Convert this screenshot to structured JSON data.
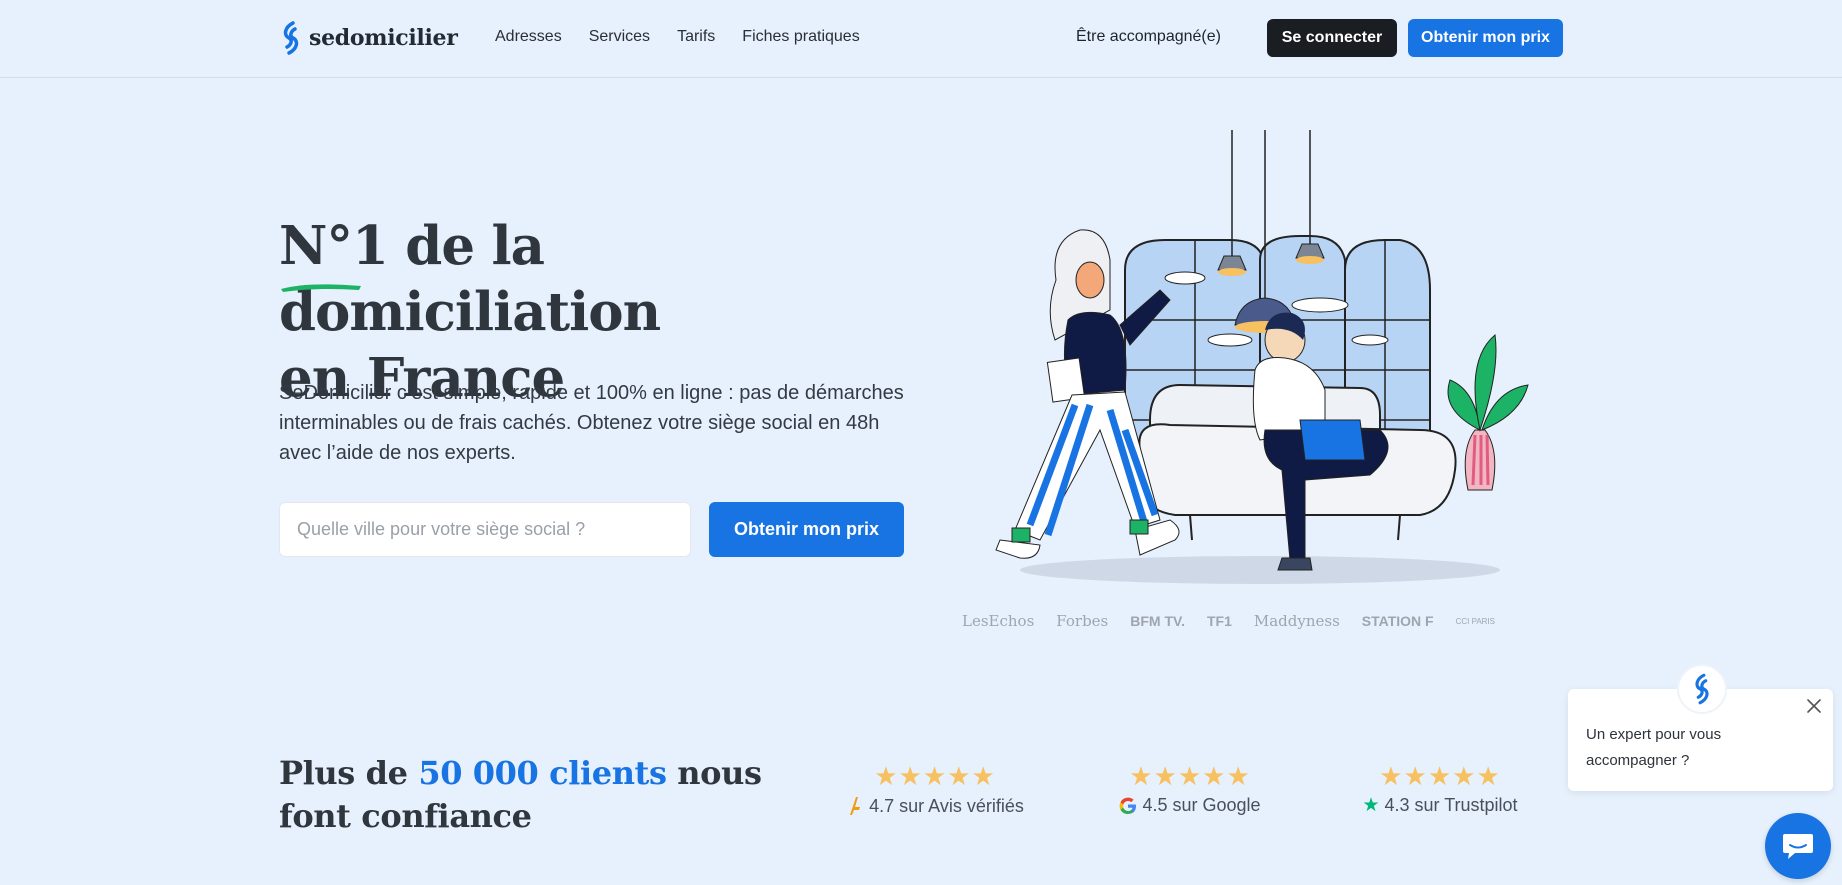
{
  "header": {
    "brand": "sedomicilier",
    "nav": [
      "Adresses",
      "Services",
      "Tarifs",
      "Fiches pratiques"
    ],
    "accompany_label": "Être accompagné(e)",
    "login_label": "Se connecter",
    "price_label": "Obtenir mon prix"
  },
  "hero": {
    "title_line1": "N°1 de la domiciliation",
    "title_line2": "en France",
    "description": "SeDomicilier c’est simple, rapide et 100% en ligne : pas de démarches interminables ou de frais cachés. Obtenez votre siège social en 48h avec l’aide de nos experts.",
    "city_placeholder": "Quelle ville pour votre siège social ?",
    "cta_label": "Obtenir mon prix"
  },
  "press": {
    "logos": [
      "LesEchos",
      "Forbes",
      "BFM TV.",
      "TF1",
      "Maddyness",
      "STATION F",
      "CCI PARIS"
    ]
  },
  "clients": {
    "title_prefix": "Plus de ",
    "title_accent": "50 000 clients",
    "title_suffix": " nous font confiance",
    "ratings": [
      {
        "stars": "★★★★★",
        "text": "4.7 sur Avis vérifiés",
        "icon": "avis-verifies-icon"
      },
      {
        "stars": "★★★★★",
        "text": "4.5 sur Google",
        "icon": "google-icon"
      },
      {
        "stars": "★★★★★",
        "text": "4.3 sur Trustpilot",
        "icon": "trustpilot-star-icon"
      }
    ]
  },
  "chat": {
    "message": "Un expert pour vous accompagner ?"
  },
  "colors": {
    "background": "#e6f1fd",
    "accent": "#1873e3",
    "dark_button": "#1a1d21",
    "stars": "#f7c061"
  }
}
